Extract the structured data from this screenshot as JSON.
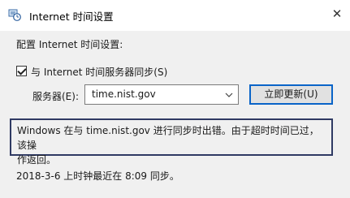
{
  "window": {
    "title": "Internet 时间设置",
    "icon": "clock-globe-icon",
    "close_glyph": "✕"
  },
  "settings": {
    "section_label": "配置 Internet 时间设置:",
    "sync_checkbox": {
      "checked": true,
      "label": "与 Internet 时间服务器同步(S)"
    },
    "server_label": "服务器(E):",
    "server_value": "time.nist.gov",
    "update_button": "立即更新(U)",
    "error_message": "Windows 在与 time.nist.gov 进行同步时出错。由于超时时间已过，该操\n作返回。",
    "last_sync_status": "2018-3-6 上时钟最近在 8:09 同步。"
  },
  "colors": {
    "dialog_bg": "#f0f0f0",
    "title_bg": "#ffffff",
    "button_focus_border": "#0a64c8",
    "message_border": "#2f3a63"
  }
}
